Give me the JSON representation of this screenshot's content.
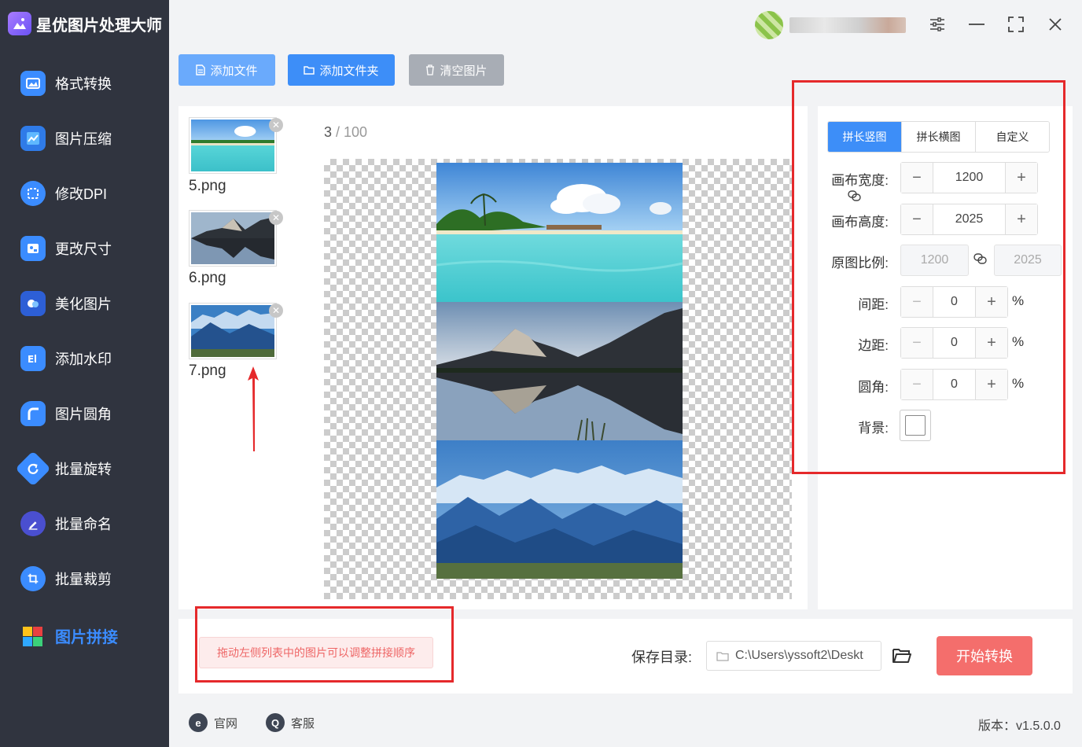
{
  "app": {
    "title": "星优图片处理大师"
  },
  "sidebar": {
    "items": [
      {
        "label": "格式转换",
        "icon": "image-convert-icon",
        "color": "#3b8cff"
      },
      {
        "label": "图片压缩",
        "icon": "image-compress-icon",
        "color": "#3b8cff"
      },
      {
        "label": "修改DPI",
        "icon": "dpi-icon",
        "color": "#3b8cff"
      },
      {
        "label": "更改尺寸",
        "icon": "resize-icon",
        "color": "#3b8cff"
      },
      {
        "label": "美化图片",
        "icon": "beautify-icon",
        "color": "#3b8cff"
      },
      {
        "label": "添加水印",
        "icon": "watermark-icon",
        "color": "#3b8cff"
      },
      {
        "label": "图片圆角",
        "icon": "round-corner-icon",
        "color": "#3b8cff"
      },
      {
        "label": "批量旋转",
        "icon": "rotate-icon",
        "color": "#3b8cff"
      },
      {
        "label": "批量命名",
        "icon": "rename-icon",
        "color": "#3b8cff"
      },
      {
        "label": "批量裁剪",
        "icon": "crop-icon",
        "color": "#3b8cff"
      },
      {
        "label": "图片拼接",
        "icon": "puzzle-icon",
        "color": "#3b8cff",
        "active": true
      }
    ]
  },
  "toolbar": {
    "add_file": "添加文件",
    "add_folder": "添加文件夹",
    "clear": "清空图片"
  },
  "files": [
    {
      "name": "5.png"
    },
    {
      "name": "6.png"
    },
    {
      "name": "7.png"
    }
  ],
  "preview": {
    "current": "3",
    "separator": " / ",
    "total": "100"
  },
  "settings": {
    "tabs": [
      "拼长竖图",
      "拼长横图",
      "自定义"
    ],
    "active_tab": "拼长竖图",
    "canvas_width_label": "画布宽度:",
    "canvas_width": "1200",
    "canvas_height_label": "画布高度:",
    "canvas_height": "2025",
    "ratio_label": "原图比例:",
    "ratio_w": "1200",
    "ratio_h": "2025",
    "gap_label": "间距:",
    "gap": "0",
    "margin_label": "边距:",
    "margin": "0",
    "radius_label": "圆角:",
    "radius": "0",
    "unit": "%",
    "bg_label": "背景:",
    "bg_color": "#ffffff"
  },
  "bottom": {
    "hint": "拖动左侧列表中的图片可以调整拼接顺序",
    "save_label": "保存目录:",
    "save_path": "C:\\Users\\yssoft2\\Deskt",
    "start": "开始转换"
  },
  "footer": {
    "website": "官网",
    "support": "客服",
    "version": "版本：v1.5.0.0"
  },
  "colors": {
    "accent": "#3d8ef8",
    "danger": "#f46e6c",
    "sidebar": "#30343f",
    "annotation": "#e5292b"
  }
}
